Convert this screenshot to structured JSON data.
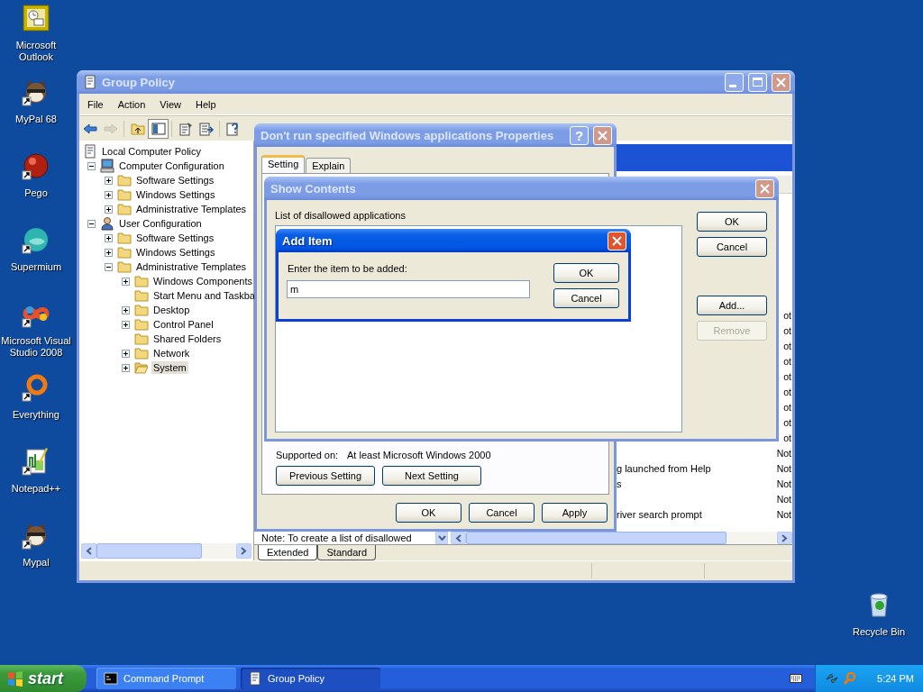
{
  "desktop_icons": [
    {
      "label": "Microsoft Outlook",
      "kind": "mail",
      "shortcut": false
    },
    {
      "label": "MyPal 68",
      "kind": "animal",
      "shortcut": true
    },
    {
      "label": "Pego",
      "kind": "sphere",
      "shortcut": true
    },
    {
      "label": "Supermium",
      "kind": "disc",
      "shortcut": true
    },
    {
      "label": "Microsoft Visual Studio 2008",
      "kind": "infinity",
      "shortcut": true
    },
    {
      "label": "Everything",
      "kind": "ring",
      "shortcut": true
    },
    {
      "label": "Notepad++",
      "kind": "notepad",
      "shortcut": true
    },
    {
      "label": "Mypal",
      "kind": "animal",
      "shortcut": true
    }
  ],
  "recycle_bin": {
    "label": "Recycle Bin",
    "kind": "bin",
    "shortcut": false
  },
  "group_policy": {
    "title": "Group Policy",
    "active": false,
    "menu": [
      "File",
      "Action",
      "View",
      "Help"
    ],
    "toolbar": [
      {
        "kind": "back",
        "disabled": false,
        "pressed": false
      },
      {
        "kind": "forward",
        "disabled": true,
        "pressed": false
      },
      {
        "kind": "up",
        "disabled": false,
        "pressed": false
      },
      {
        "kind": "pane",
        "disabled": false,
        "pressed": true
      },
      {
        "kind": "properties",
        "disabled": false,
        "pressed": false
      },
      {
        "kind": "export",
        "disabled": false,
        "pressed": false
      },
      {
        "kind": "help",
        "disabled": false,
        "pressed": false
      }
    ],
    "tree": [
      {
        "label": "Local Computer Policy",
        "kind": "policy",
        "selected": false,
        "children": [
          {
            "label": "Computer Configuration",
            "kind": "computer",
            "expanded": true,
            "selected": false,
            "children": [
              {
                "label": "Software Settings",
                "kind": "folder",
                "expanded": false,
                "selected": false
              },
              {
                "label": "Windows Settings",
                "kind": "folder",
                "expanded": false,
                "selected": false
              },
              {
                "label": "Administrative Templates",
                "kind": "folder",
                "expanded": false,
                "selected": false
              }
            ]
          },
          {
            "label": "User Configuration",
            "kind": "user",
            "expanded": true,
            "selected": false,
            "children": [
              {
                "label": "Software Settings",
                "kind": "folder",
                "expanded": false,
                "selected": false
              },
              {
                "label": "Windows Settings",
                "kind": "folder",
                "expanded": false,
                "selected": false
              },
              {
                "label": "Administrative Templates",
                "kind": "folder",
                "expanded": true,
                "selected": false,
                "children": [
                  {
                    "label": "Windows Components",
                    "kind": "folder",
                    "expanded": false,
                    "selected": false
                  },
                  {
                    "label": "Start Menu and Taskba",
                    "kind": "folder",
                    "selected": false
                  },
                  {
                    "label": "Desktop",
                    "kind": "folder",
                    "expanded": false,
                    "selected": false
                  },
                  {
                    "label": "Control Panel",
                    "kind": "folder",
                    "expanded": false,
                    "selected": false
                  },
                  {
                    "label": "Shared Folders",
                    "kind": "folder",
                    "selected": false
                  },
                  {
                    "label": "Network",
                    "kind": "folder",
                    "expanded": false,
                    "selected": false
                  },
                  {
                    "label": "System",
                    "kind": "folder",
                    "expanded": false,
                    "selected": true
                  }
                ]
              }
            ]
          }
        ]
      }
    ],
    "policy_rows": [
      {
        "state": "ot"
      },
      {
        "state": "ot"
      },
      {
        "state": "ot"
      },
      {
        "state": "ot"
      },
      {
        "state": "ot"
      },
      {
        "state": "ot"
      },
      {
        "state": "ot"
      },
      {
        "state": "ot"
      },
      {
        "state": "ot"
      },
      {
        "state": "Not"
      },
      {
        "name": "g launched from Help",
        "state": "Not"
      },
      {
        "name": "s",
        "state": "Not"
      },
      {
        "state": "Not"
      },
      {
        "name": "river search prompt",
        "state": "Not"
      }
    ],
    "note": "Note: To create a list of disallowed",
    "view_tabs": [
      {
        "label": "Extended",
        "selected": true
      },
      {
        "label": "Standard",
        "selected": false
      }
    ]
  },
  "properties_dialog": {
    "title": "Don't run specified Windows applications Properties",
    "active": false,
    "help_glyph": "?",
    "tabs": [
      {
        "label": "Setting",
        "selected": true
      },
      {
        "label": "Explain",
        "selected": false
      }
    ],
    "supported_label": "Supported on:",
    "supported_value": "At least Microsoft Windows 2000",
    "nav_buttons": [
      "Previous Setting",
      "Next Setting"
    ],
    "buttons": [
      "OK",
      "Cancel",
      "Apply"
    ]
  },
  "show_contents": {
    "title": "Show Contents",
    "active": false,
    "list_label": "List of disallowed applications",
    "buttons": [
      {
        "label": "OK",
        "disabled": false
      },
      {
        "label": "Cancel",
        "disabled": false
      },
      {
        "label": "Add...",
        "disabled": false
      },
      {
        "label": "Remove",
        "disabled": true
      }
    ]
  },
  "add_item": {
    "title": "Add Item",
    "active": true,
    "prompt": "Enter the item to be added:",
    "value": "m",
    "buttons": [
      "OK",
      "Cancel"
    ]
  },
  "taskbar": {
    "start": "start",
    "tasks": [
      {
        "label": "Command Prompt",
        "kind": "console",
        "selected": false
      },
      {
        "label": "Group Policy",
        "kind": "policy",
        "selected": true
      }
    ],
    "clock": "5:24 PM"
  }
}
